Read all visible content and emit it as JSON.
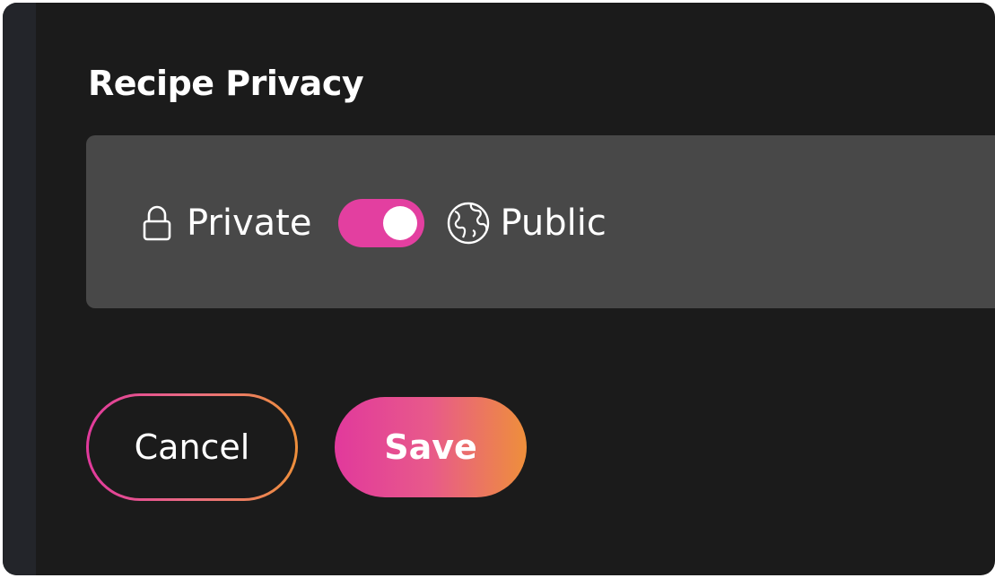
{
  "title": "Recipe Privacy",
  "privacy": {
    "private_label": "Private",
    "public_label": "Public",
    "toggle_state": "public",
    "private_icon": "lock-icon",
    "public_icon": "globe-icon"
  },
  "actions": {
    "cancel_label": "Cancel",
    "save_label": "Save"
  },
  "colors": {
    "background": "#1b1b1b",
    "panel": "#484848",
    "accent_pink": "#e33fa0",
    "accent_orange": "#ee8f3b",
    "text": "#ffffff"
  }
}
